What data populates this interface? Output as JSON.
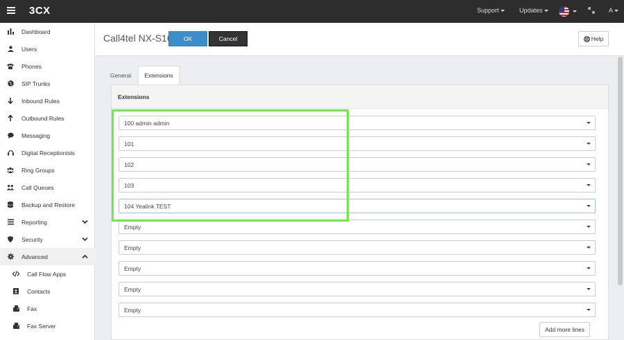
{
  "topbar": {
    "logo": "3CX",
    "support_label": "Support",
    "updates_label": "Updates",
    "user_label": "A"
  },
  "sidebar": {
    "items": [
      {
        "label": "Dashboard",
        "icon": "bar-chart-icon"
      },
      {
        "label": "Users",
        "icon": "user-icon"
      },
      {
        "label": "Phones",
        "icon": "phone-icon"
      },
      {
        "label": "SIP Trunks",
        "icon": "globe-icon"
      },
      {
        "label": "Inbound Rules",
        "icon": "arrow-down-icon"
      },
      {
        "label": "Outbound Rules",
        "icon": "arrow-up-icon"
      },
      {
        "label": "Messaging",
        "icon": "chat-icon"
      },
      {
        "label": "Digital Receptionists",
        "icon": "headset-icon"
      },
      {
        "label": "Ring Groups",
        "icon": "group-icon"
      },
      {
        "label": "Call Queues",
        "icon": "queue-icon"
      },
      {
        "label": "Backup and Restore",
        "icon": "database-icon"
      },
      {
        "label": "Reporting",
        "icon": "list-icon"
      },
      {
        "label": "Security",
        "icon": "shield-icon"
      },
      {
        "label": "Advanced",
        "icon": "gear-icon"
      },
      {
        "label": "Call Flow Apps",
        "icon": "code-icon"
      },
      {
        "label": "Contacts",
        "icon": "contact-icon"
      },
      {
        "label": "Fax",
        "icon": "fax-icon"
      },
      {
        "label": "Fax Server",
        "icon": "fax-icon"
      }
    ]
  },
  "header": {
    "title": "Call4tel NX-S16",
    "ok_label": "OK",
    "cancel_label": "Cancel",
    "help_label": "Help"
  },
  "tabs": [
    {
      "label": "General"
    },
    {
      "label": "Extensions"
    }
  ],
  "panel": {
    "title": "Extensions",
    "lines": [
      "100 admin admin",
      "101",
      "102",
      "103",
      "104 Yealink TEST",
      "Empty",
      "Empty",
      "Empty",
      "Empty",
      "Empty"
    ],
    "add_more_label": "Add more lines"
  },
  "colors": {
    "topbar": "#2d2d2d",
    "ok_button": "#3c8dcb",
    "cancel_button": "#333333",
    "highlight": "#6fe84a"
  }
}
